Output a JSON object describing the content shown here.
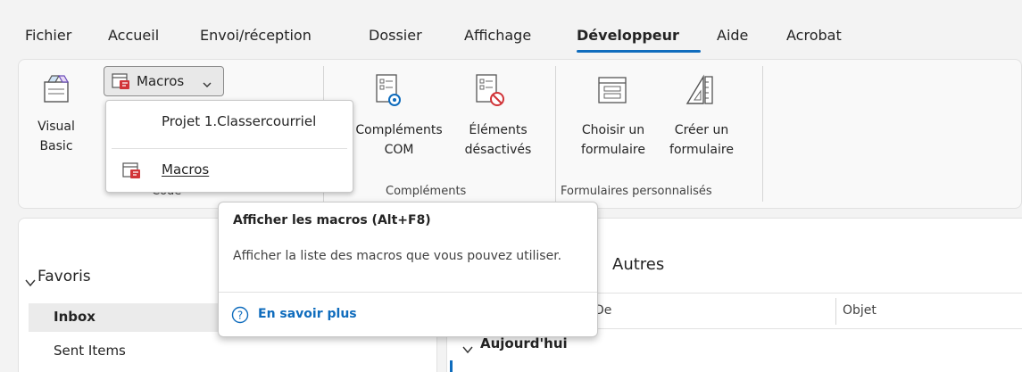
{
  "tabs": [
    {
      "label": "Fichier"
    },
    {
      "label": "Accueil"
    },
    {
      "label": "Envoi/réception"
    },
    {
      "label": "Dossier"
    },
    {
      "label": "Affichage"
    },
    {
      "label": "Développeur"
    },
    {
      "label": "Aide"
    },
    {
      "label": "Acrobat"
    }
  ],
  "active_tab": "Développeur",
  "ribbon": {
    "visual_basic": {
      "line1": "Visual",
      "line2": "Basic",
      "icon": "visual-basic-icon"
    },
    "macros_button": {
      "label": "Macros",
      "icon": "macros-icon",
      "chevron": "chevron-down-icon"
    },
    "code_group": "Code",
    "complements_com": {
      "line1": "Compléments",
      "line2": "COM",
      "icon": "com-addins-icon"
    },
    "elements_desactives": {
      "line1": "Éléments",
      "line2": "désactivés",
      "icon": "disabled-items-icon"
    },
    "complements_group": "Compléments",
    "choisir_formulaire": {
      "line1": "Choisir un",
      "line2": "formulaire",
      "icon": "choose-form-icon"
    },
    "creer_formulaire": {
      "line1": "Créer un",
      "line2": "formulaire",
      "icon": "design-form-icon"
    },
    "forms_group": "Formulaires personnalisés"
  },
  "dropdown": {
    "item1": "Projet 1.Classercourriel",
    "item2": "Macros"
  },
  "tooltip": {
    "title": "Afficher les macros (Alt+F8)",
    "description": "Afficher la liste des macros que vous pouvez utiliser.",
    "learn_more": "En savoir plus"
  },
  "nav": {
    "favorites_label": "Favoris",
    "items": [
      {
        "label": "Inbox"
      },
      {
        "label": "Sent Items"
      }
    ]
  },
  "main": {
    "filter_tab": "Autres",
    "columns": [
      "De",
      "Objet"
    ],
    "group_header": "Aujourd'hui"
  },
  "colors": {
    "accent": "#0f6cbd",
    "macro_red": "#d13438"
  }
}
